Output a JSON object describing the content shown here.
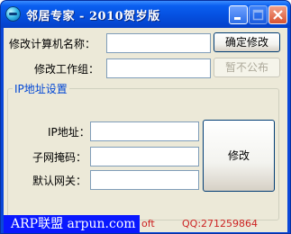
{
  "window": {
    "title": "邻居专家 - 2010贺岁版"
  },
  "form": {
    "computer_name_label": "修改计算机名称：",
    "computer_name_value": "",
    "workgroup_label": "修改工作组：",
    "workgroup_value": "",
    "confirm_button": "确定修改",
    "hidden_button": "暂不公布"
  },
  "ip_group": {
    "title": "IP地址设置",
    "ip_label": "IP地址：",
    "mask_label": "子网掩码：",
    "gateway_label": "默认网关：",
    "ip_value": "",
    "mask_value": "",
    "gateway_value": "",
    "modify_button": "修改"
  },
  "footer": {
    "banner": "ARP联盟 arpun.com",
    "soft_text": "oft",
    "qq_text": "QQ:271259864"
  },
  "icons": [
    "app-icon",
    "minimize-icon",
    "maximize-icon",
    "close-icon"
  ]
}
